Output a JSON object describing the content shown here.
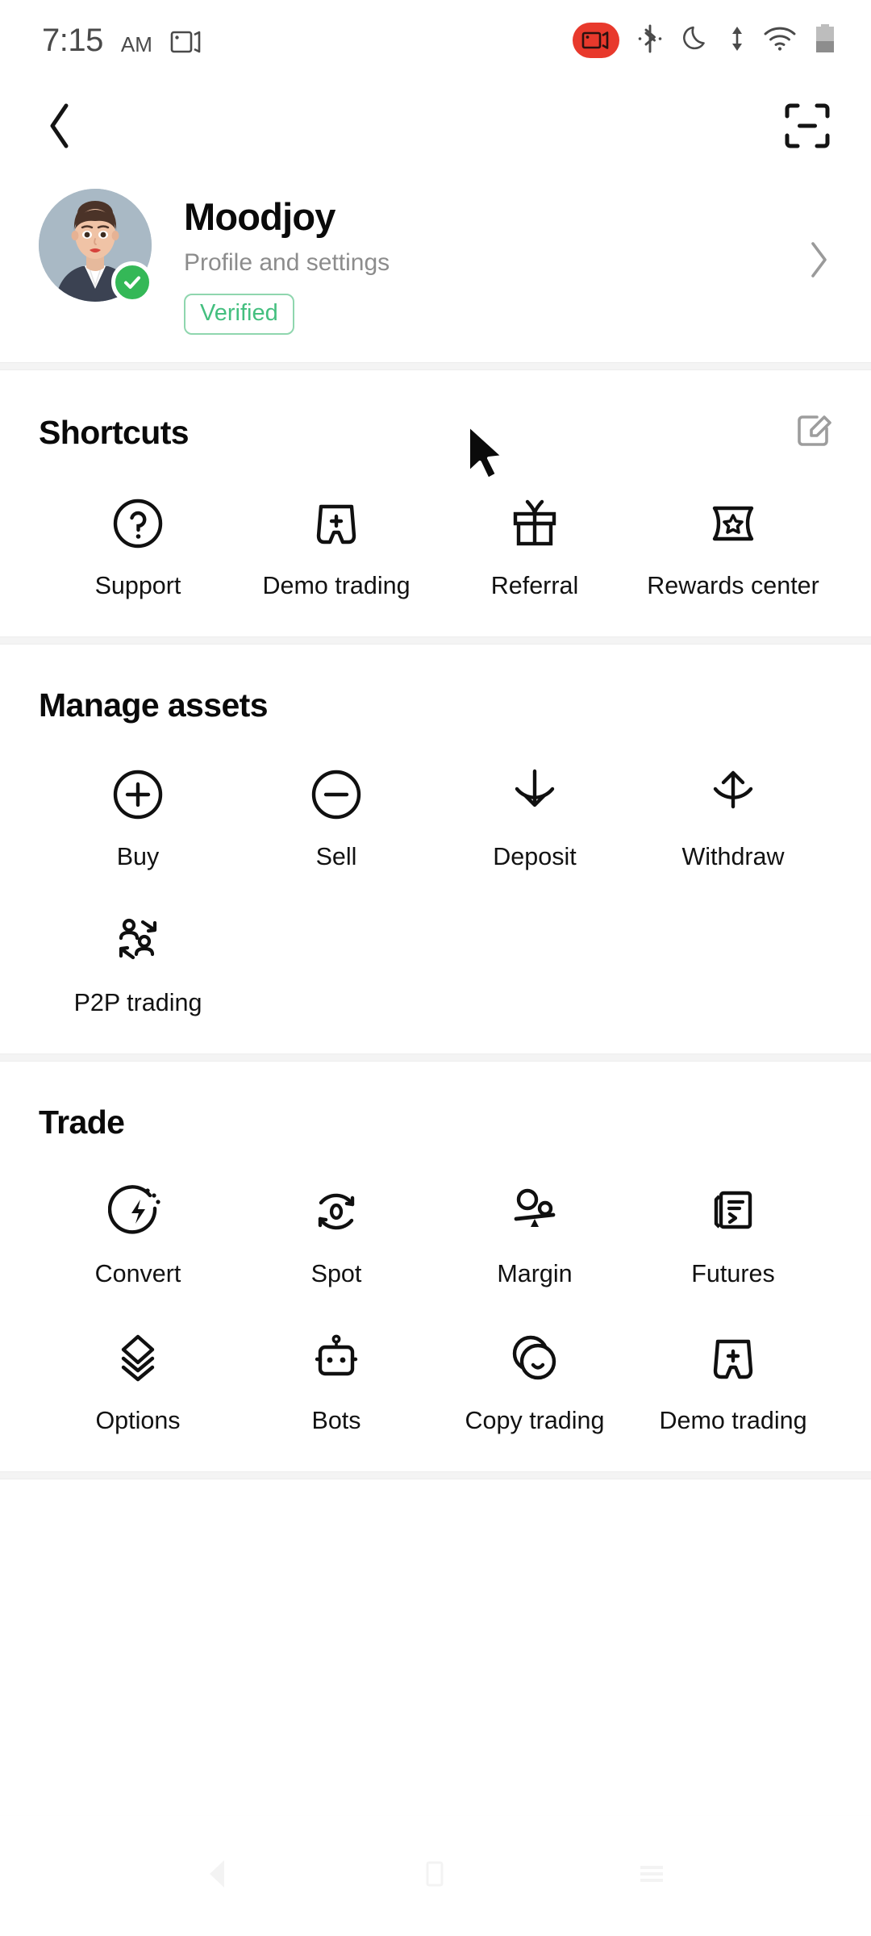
{
  "statusbar": {
    "time": "7:15",
    "ampm": "AM",
    "icons": [
      "screen-cast-icon",
      "screen-recording-icon",
      "bluetooth-icon",
      "do-not-disturb-moon-icon",
      "data-transfer-icon",
      "wifi-icon",
      "battery-icon"
    ]
  },
  "navbar": {
    "back_icon": "chevron-left-icon",
    "scan_icon": "qr-scan-icon"
  },
  "profile": {
    "name": "Moodjoy",
    "subtitle": "Profile and settings",
    "verified_label": "Verified",
    "chevron_icon": "chevron-right-icon",
    "avatar_alt": "user-avatar",
    "verified_check_icon": "check-badge-icon"
  },
  "colors": {
    "accent_green": "#34b857",
    "verified_text": "#44bf7f",
    "verified_border": "#8fd6ae",
    "record_red": "#e8392c",
    "text_primary": "#0a0a0a",
    "text_secondary": "#8c8c8c",
    "divider": "#f4f4f4"
  },
  "sections": [
    {
      "title": "Shortcuts",
      "action_icon": "edit-pencil-icon",
      "items": [
        {
          "label": "Support",
          "icon": "question-circle-icon"
        },
        {
          "label": "Demo trading",
          "icon": "gamepad-plus-icon"
        },
        {
          "label": "Referral",
          "icon": "gift-icon"
        },
        {
          "label": "Rewards center",
          "icon": "ticket-star-icon"
        }
      ]
    },
    {
      "title": "Manage assets",
      "items": [
        {
          "label": "Buy",
          "icon": "plus-circle-icon"
        },
        {
          "label": "Sell",
          "icon": "minus-circle-icon"
        },
        {
          "label": "Deposit",
          "icon": "arrow-down-into-icon"
        },
        {
          "label": "Withdraw",
          "icon": "arrow-up-out-icon"
        },
        {
          "label": "P2P trading",
          "icon": "people-exchange-icon"
        }
      ]
    },
    {
      "title": "Trade",
      "items": [
        {
          "label": "Convert",
          "icon": "lightning-circle-icon"
        },
        {
          "label": "Spot",
          "icon": "circular-arrows-dot-icon"
        },
        {
          "label": "Margin",
          "icon": "balance-scale-icon"
        },
        {
          "label": "Futures",
          "icon": "document-chevron-icon"
        },
        {
          "label": "Options",
          "icon": "layers-chevron-icon"
        },
        {
          "label": "Bots",
          "icon": "robot-icon"
        },
        {
          "label": "Copy trading",
          "icon": "overlapping-circles-smile-icon"
        },
        {
          "label": "Demo trading",
          "icon": "gamepad-plus-icon"
        }
      ]
    }
  ],
  "androidnav": {
    "back": "triangle-back-icon",
    "home": "square-home-icon",
    "recents": "lines-recents-icon"
  }
}
